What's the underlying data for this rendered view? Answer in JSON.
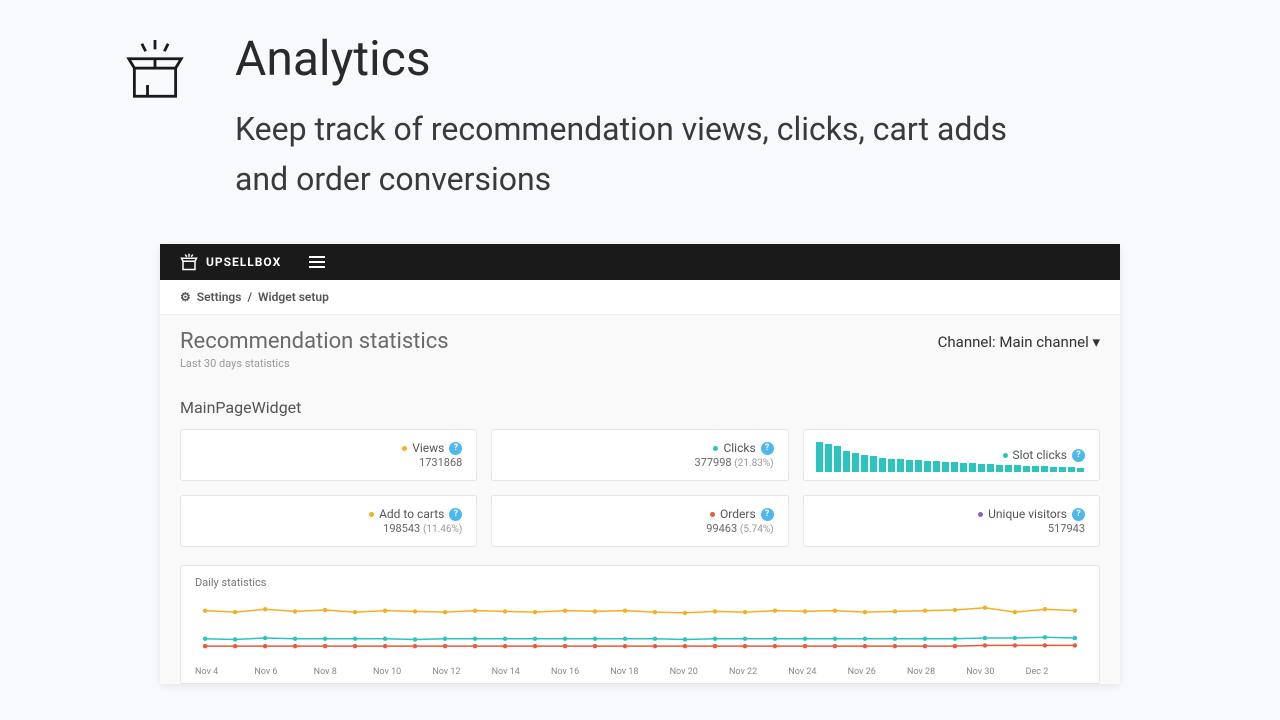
{
  "hero": {
    "title": "Analytics",
    "subtitle": "Keep track of recommendation views, clicks, cart adds and order conversions"
  },
  "topbar": {
    "brand": "UPSELLBOX"
  },
  "breadcrumb": {
    "settings": "Settings",
    "current": "Widget setup"
  },
  "page": {
    "title": "Recommendation statistics",
    "subtitle": "Last 30 days statistics",
    "channel_label": "Channel:",
    "channel_value": "Main channel"
  },
  "widget": {
    "name": "MainPageWidget"
  },
  "cards": {
    "views": {
      "label": "Views",
      "value": "1731868",
      "pct": "",
      "color": "#f3b024"
    },
    "clicks": {
      "label": "Clicks",
      "value": "377998",
      "pct": "(21.83%)",
      "color": "#2bc4bf"
    },
    "slot": {
      "label": "Slot clicks",
      "value": "",
      "pct": "",
      "color": "#2bc4bf"
    },
    "add": {
      "label": "Add to carts",
      "value": "198543",
      "pct": "(11.46%)",
      "color": "#f3b024"
    },
    "orders": {
      "label": "Orders",
      "value": "99463",
      "pct": "(5.74%)",
      "color": "#e85a3a"
    },
    "unique": {
      "label": "Unique visitors",
      "value": "517943",
      "pct": "",
      "color": "#8a5fc2"
    }
  },
  "chart_data": {
    "type": "bar",
    "title": "Slot clicks sparkline",
    "series": [
      {
        "name": "Slot clicks",
        "values": [
          28,
          26,
          24,
          19,
          17,
          15,
          14,
          12,
          11,
          11,
          10,
          10,
          9,
          9,
          8,
          8,
          7,
          7,
          6,
          6,
          5,
          5,
          5,
          4,
          4,
          4,
          3,
          3,
          3,
          2
        ]
      }
    ]
  },
  "daily": {
    "title": "Daily statistics",
    "type": "line",
    "x_labels": [
      "Nov 4",
      "Nov 6",
      "Nov 8",
      "Nov 10",
      "Nov 12",
      "Nov 14",
      "Nov 16",
      "Nov 18",
      "Nov 20",
      "Nov 22",
      "Nov 24",
      "Nov 26",
      "Nov 28",
      "Nov 30",
      "Dec 2"
    ],
    "series": [
      {
        "name": "Views",
        "color": "#f3b024",
        "values": [
          60,
          58,
          62,
          59,
          61,
          58,
          60,
          59,
          58,
          60,
          59,
          58,
          60,
          59,
          60,
          58,
          57,
          59,
          58,
          60,
          59,
          60,
          58,
          59,
          60,
          61,
          64,
          58,
          62,
          60
        ]
      },
      {
        "name": "Clicks",
        "color": "#2bc4bf",
        "values": [
          22,
          21,
          23,
          22,
          22,
          22,
          22,
          21,
          22,
          22,
          22,
          22,
          22,
          22,
          22,
          22,
          21,
          22,
          22,
          22,
          22,
          22,
          22,
          22,
          22,
          22,
          23,
          23,
          24,
          23
        ]
      },
      {
        "name": "Orders",
        "color": "#e85a3a",
        "values": [
          12,
          12,
          12,
          12,
          12,
          12,
          12,
          12,
          12,
          12,
          12,
          12,
          12,
          12,
          12,
          12,
          12,
          12,
          12,
          12,
          12,
          12,
          12,
          12,
          12,
          12,
          13,
          13,
          13,
          13
        ]
      }
    ]
  }
}
